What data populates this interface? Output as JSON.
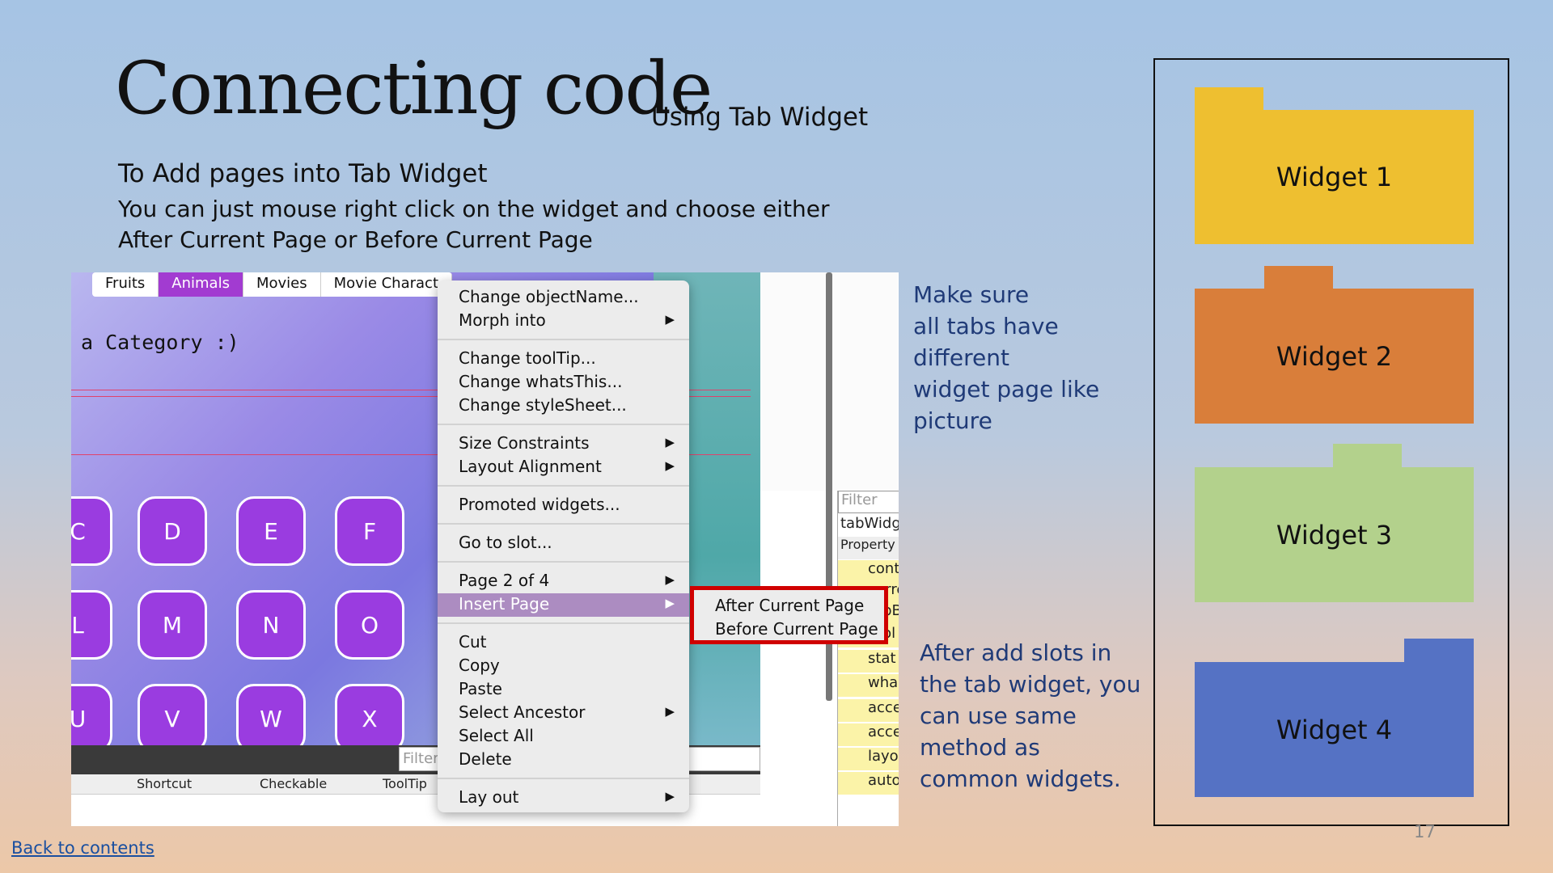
{
  "slide": {
    "title": "Connecting code",
    "subtitle": "Using Tab Widget",
    "heading": "To Add pages into Tab Widget",
    "description": "You can just mouse right click on the widget and choose either After Current Page or Before Current Page",
    "note_top": [
      "Make sure",
      "all tabs have different",
      "widget page like",
      "picture"
    ],
    "note_bottom": [
      "After add slots in",
      "the tab widget, you",
      "can use same",
      "method as",
      "common widgets."
    ],
    "back_link": "Back to contents",
    "page_number": "17"
  },
  "designer": {
    "tabs": [
      {
        "label": "Fruits",
        "active": false
      },
      {
        "label": "Animals",
        "active": true
      },
      {
        "label": "Movies",
        "active": false
      },
      {
        "label": "Movie Charact",
        "active": false
      }
    ],
    "category_label": "a Category :)",
    "keys": [
      [
        "C",
        "D",
        "E",
        "F"
      ],
      [
        "L",
        "M",
        "N",
        "O"
      ],
      [
        "U",
        "V",
        "W",
        "X"
      ]
    ],
    "filter_placeholder": "Filter",
    "columns": [
      "Shortcut",
      "Checkable",
      "ToolTip"
    ],
    "property_filter": "Filter",
    "property_object": "tabWidg",
    "property_header": "Property",
    "property_rows": [
      "cont",
      "curre",
      "tabBarAu",
      "tool",
      "stat",
      "wha",
      "acce",
      "acce",
      "layo",
      "auto"
    ]
  },
  "context_menu": {
    "items": [
      {
        "label": "Change objectName...",
        "submenu": false
      },
      {
        "label": "Morph into",
        "submenu": true
      },
      {
        "label": "Change toolTip...",
        "submenu": false
      },
      {
        "label": "Change whatsThis...",
        "submenu": false
      },
      {
        "label": "Change styleSheet...",
        "submenu": false
      },
      {
        "label": "Size Constraints",
        "submenu": true
      },
      {
        "label": "Layout Alignment",
        "submenu": true
      },
      {
        "label": "Promoted widgets...",
        "submenu": false
      },
      {
        "label": "Go to slot...",
        "submenu": false
      },
      {
        "label": "Page 2 of 4",
        "submenu": true
      },
      {
        "label": "Insert Page",
        "submenu": true,
        "highlighted": true
      },
      {
        "label": "Cut",
        "submenu": false
      },
      {
        "label": "Copy",
        "submenu": false
      },
      {
        "label": "Paste",
        "submenu": false
      },
      {
        "label": "Select Ancestor",
        "submenu": true
      },
      {
        "label": "Select All",
        "submenu": false
      },
      {
        "label": "Delete",
        "submenu": false
      },
      {
        "label": "Lay out",
        "submenu": true
      }
    ],
    "submenu_items": [
      "After Current Page",
      "Before Current Page"
    ],
    "arrow_glyph": "▶"
  },
  "widgets_diagram": [
    {
      "label": "Widget 1",
      "color": "#eebf30"
    },
    {
      "label": "Widget 2",
      "color": "#d97e3a"
    },
    {
      "label": "Widget 3",
      "color": "#b3d18c"
    },
    {
      "label": "Widget 4",
      "color": "#5572c4"
    }
  ]
}
